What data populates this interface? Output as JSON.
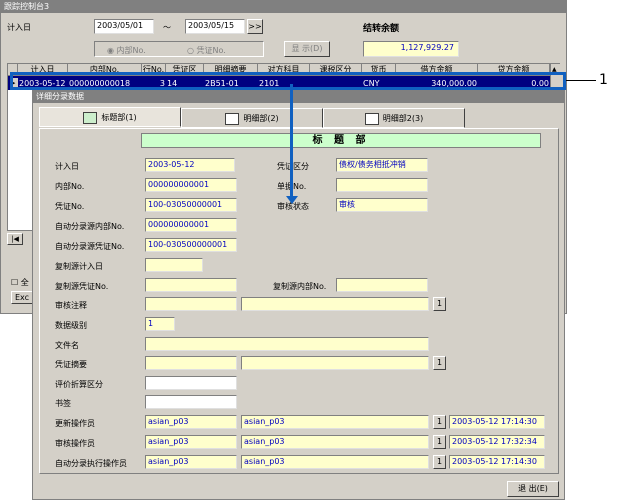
{
  "main": {
    "title": "跟踪控制台3",
    "date_label": "计入日",
    "date_from": "2003/05/01",
    "tilde": "～",
    "date_to": "2003/05/15",
    "jump_btn": ">>",
    "balance_label": "结转余额",
    "balance_value": "1,127,929.27",
    "radio_internal": "内部No.",
    "radio_voucher": "凭证No.",
    "show_btn": "显 示(D)",
    "columns": [
      "计入日",
      "内部No.",
      "行No.",
      "凭证区",
      "明细摘要",
      "对方科目",
      "课税区分",
      "货币",
      "借方金额",
      "贷方金额"
    ],
    "row": [
      "2003-05-12",
      "000000000018",
      "3",
      "14",
      "2B51-01",
      "2101",
      "",
      "CNY",
      "340,000.00",
      "0.00"
    ],
    "nav_first": "|◀",
    "all_chk": "全",
    "excel_btn": "Exc"
  },
  "annotation": {
    "number": "1"
  },
  "dialog": {
    "title": "详细分录数据",
    "tabs": [
      "标题部(1)",
      "明细部(2)",
      "明细部2(3)"
    ],
    "header": "标 题 部",
    "labels": {
      "date": "计入日",
      "voucher_kind": "凭证区分",
      "internal_no": "内部No.",
      "single_no": "单据No.",
      "voucher_no": "凭证No.",
      "review_status": "审核状态",
      "auto_internal": "自动分录源内部No.",
      "auto_voucher": "自动分录源凭证No.",
      "copy_date": "复制源计入日",
      "copy_voucher": "复制源凭证No.",
      "copy_internal": "复制源内部No.",
      "review_note": "审核注释",
      "data_level": "数据级别",
      "file_name": "文件名",
      "voucher_summary": "凭证摘要",
      "eval_kind": "评价折算区分",
      "bookmark": "书签",
      "update_user": "更新操作员",
      "review_user": "审核操作员",
      "auto_user": "自动分录执行操作员"
    },
    "values": {
      "date": "2003-05-12",
      "voucher_kind": "债权/债务相抵冲销",
      "internal_no": "000000000001",
      "voucher_no": "100-03050000001",
      "review_status": "审核",
      "auto_internal": "000000000001",
      "auto_voucher": "100-030500000001",
      "data_level": "1",
      "update_user_id": "asian_p03",
      "update_user_name": "asian_p03",
      "update_time": "2003-05-12 17:14:30",
      "review_user_id": "asian_p03",
      "review_user_name": "asian_p03",
      "review_time": "2003-05-12 17:32:34",
      "auto_user_id": "asian_p03",
      "auto_user_name": "asian_p03",
      "auto_time": "2003-05-12 17:14:30"
    },
    "small_btn": "1",
    "close_btn": "退 出(E)"
  }
}
